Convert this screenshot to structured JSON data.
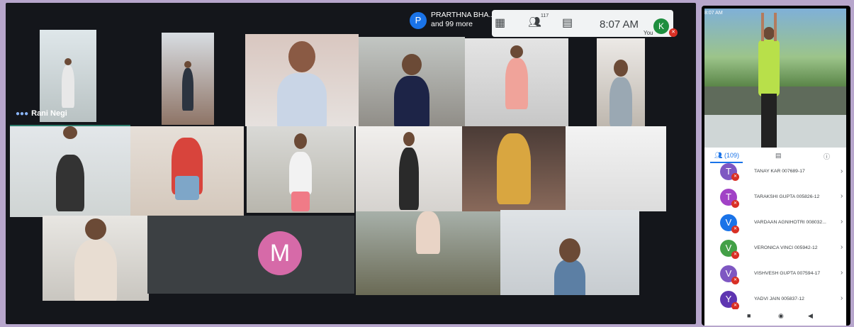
{
  "meeting": {
    "presenter_initial": "P",
    "presenter_name": "PRARTHNA BHA...",
    "presenter_more": "and 99 more",
    "participants_count": "117",
    "clock": "8:07 AM",
    "you_label": "You",
    "self_initial": "K",
    "pinned_name": "Rani Negi",
    "avatar_initial": "M",
    "icons": [
      "grid-layout-icon",
      "people-icon",
      "chat-icon",
      "mic-off-icon"
    ]
  },
  "phone": {
    "status_time": "8:07 AM",
    "tabs": [
      {
        "label": "(109)",
        "icon": "people-icon"
      },
      {
        "label": "",
        "icon": "chat-icon"
      },
      {
        "label": "",
        "icon": "info-icon"
      }
    ],
    "participants": [
      {
        "initial": "T",
        "name": "TANAY KAR 007689-17",
        "color": "#7e57c2"
      },
      {
        "initial": "T",
        "name": "TARAKSHI GUPTA 005826-12",
        "color": "#a142c6"
      },
      {
        "initial": "V",
        "name": "VARDAAN AGNIHOTRI 008032...",
        "color": "#1a73e8"
      },
      {
        "initial": "V",
        "name": "VERONICA VINCI 005942-12",
        "color": "#43a047"
      },
      {
        "initial": "V",
        "name": "VISHVESH GUPTA 007594-17",
        "color": "#7e57c2"
      },
      {
        "initial": "Y",
        "name": "YADVI JAIN 005837-12",
        "color": "#5e35b1"
      }
    ],
    "nav": [
      "■",
      "◉",
      "◀"
    ]
  }
}
